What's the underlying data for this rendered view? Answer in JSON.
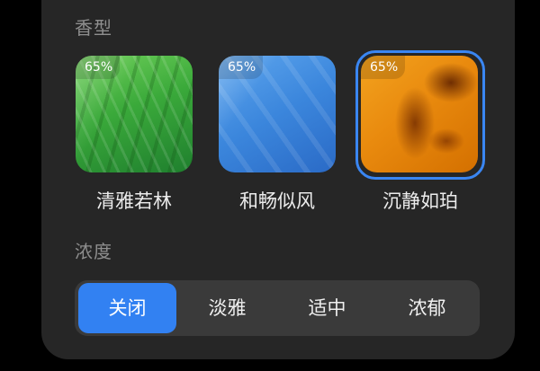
{
  "scent_section": {
    "label": "香型",
    "cards": [
      {
        "name": "清雅若林",
        "percent": "65%",
        "selected": false,
        "theme": "green-forest"
      },
      {
        "name": "和畅似风",
        "percent": "65%",
        "selected": false,
        "theme": "blue-breeze"
      },
      {
        "name": "沉静如珀",
        "percent": "65%",
        "selected": true,
        "theme": "amber"
      }
    ]
  },
  "intensity_section": {
    "label": "浓度",
    "options": [
      {
        "label": "关闭",
        "active": true
      },
      {
        "label": "淡雅",
        "active": false
      },
      {
        "label": "适中",
        "active": false
      },
      {
        "label": "浓郁",
        "active": false
      }
    ]
  },
  "colors": {
    "panel": "#262626",
    "accent": "#3281f2",
    "segment_track": "#3a3a3a",
    "label_gray": "#8e8e8e"
  }
}
